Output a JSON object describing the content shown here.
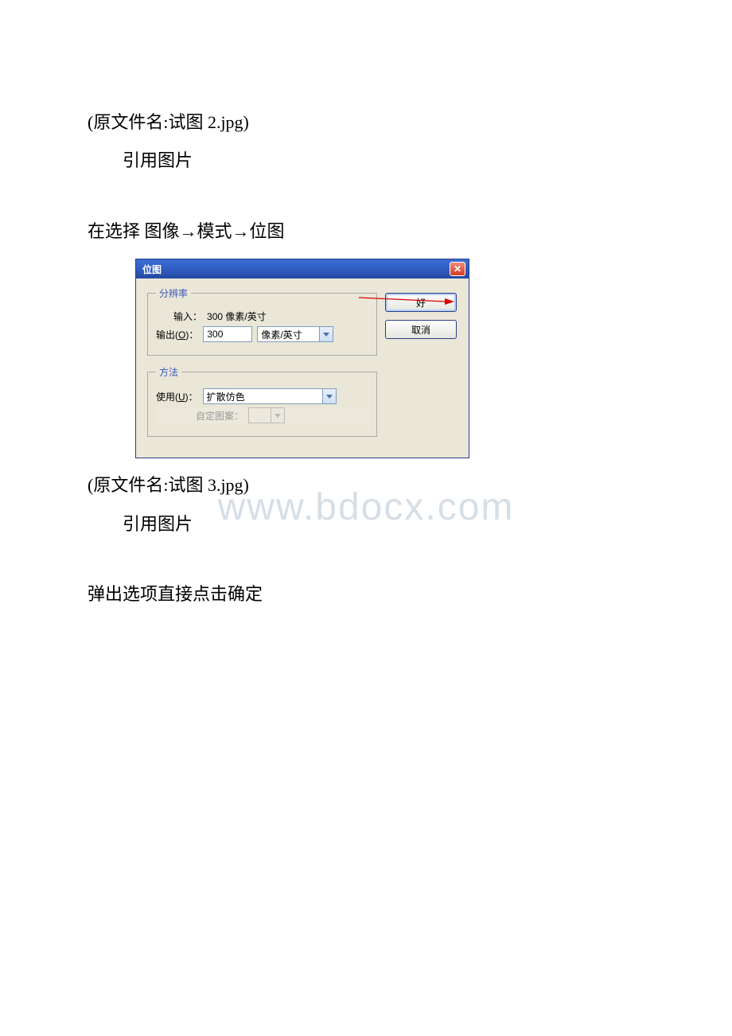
{
  "doc": {
    "line1": "(原文件名:试图 2.jpg)",
    "line2": "引用图片",
    "line3": "在选择 图像→模式→位图",
    "line4": "(原文件名:试图 3.jpg)",
    "line5": "引用图片",
    "line6": "弹出选项直接点击确定"
  },
  "dialog": {
    "title": "位图",
    "close": "✕",
    "group_resolution_legend": "分辨率",
    "input_label": "输入：",
    "input_value": "300 像素/英寸",
    "output_label_prefix": "输出(",
    "output_label_mnemonic": "O",
    "output_label_suffix": ")：",
    "output_value": "300",
    "output_unit": "像素/英寸",
    "group_method_legend": "方法",
    "use_label_prefix": "使用(",
    "use_label_mnemonic": "U",
    "use_label_suffix": ")：",
    "use_value": "扩散仿色",
    "custom_pattern_label": "自定图案：",
    "ok_button": "好",
    "cancel_button": "取消"
  },
  "watermark": "www.bdocx.com"
}
